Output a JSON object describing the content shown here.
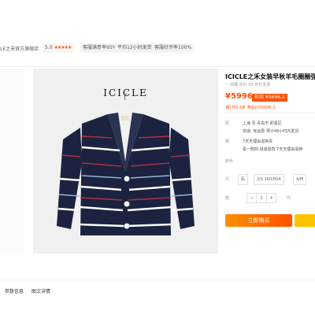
{
  "shop": {
    "store_name": "LE之禾官方旗舰店",
    "rating_value": "5.0",
    "stars": "★★★★★",
    "badges": [
      "客服满意率95%",
      "平均12小时发货",
      "客服好评率100%"
    ]
  },
  "product": {
    "brand_logo_text": "ICICLE",
    "title": "ICICLE之禾女装早秋羊毛圈圈强",
    "stats": "♡ 收藏   评价 55   可开发票",
    "price": "¥5996",
    "discount_label": "折后 ¥5696.2",
    "promo": "满1件9.5折 券后价¥5696.2",
    "fields": [
      {
        "label": "配",
        "value": "上海  至  青岛市 即墨区"
      },
      {
        "label": "",
        "value": "快递: 免运费  预计48小时内发货"
      },
      {
        "label": "服",
        "value": "7天无理由退换货"
      },
      {
        "label": "",
        "value": "看一赔四 极速退款 7天无理由退换"
      },
      {
        "label": "颜色",
        "value": ""
      }
    ],
    "sizes_label": "尺",
    "sizes": [
      "码",
      "2/S 160/80A",
      "4/M"
    ],
    "qty_label": "数",
    "quantity": "1",
    "stock_text": "件"
  },
  "actions": {
    "buy_now": "立即购买"
  },
  "tabs": [
    "参数信息",
    "图文详情"
  ],
  "colors": {
    "accent": "#ff5000",
    "buy_gradient_start": "#ff9000",
    "cart": "#ffc400",
    "navy": "#1b2340"
  }
}
